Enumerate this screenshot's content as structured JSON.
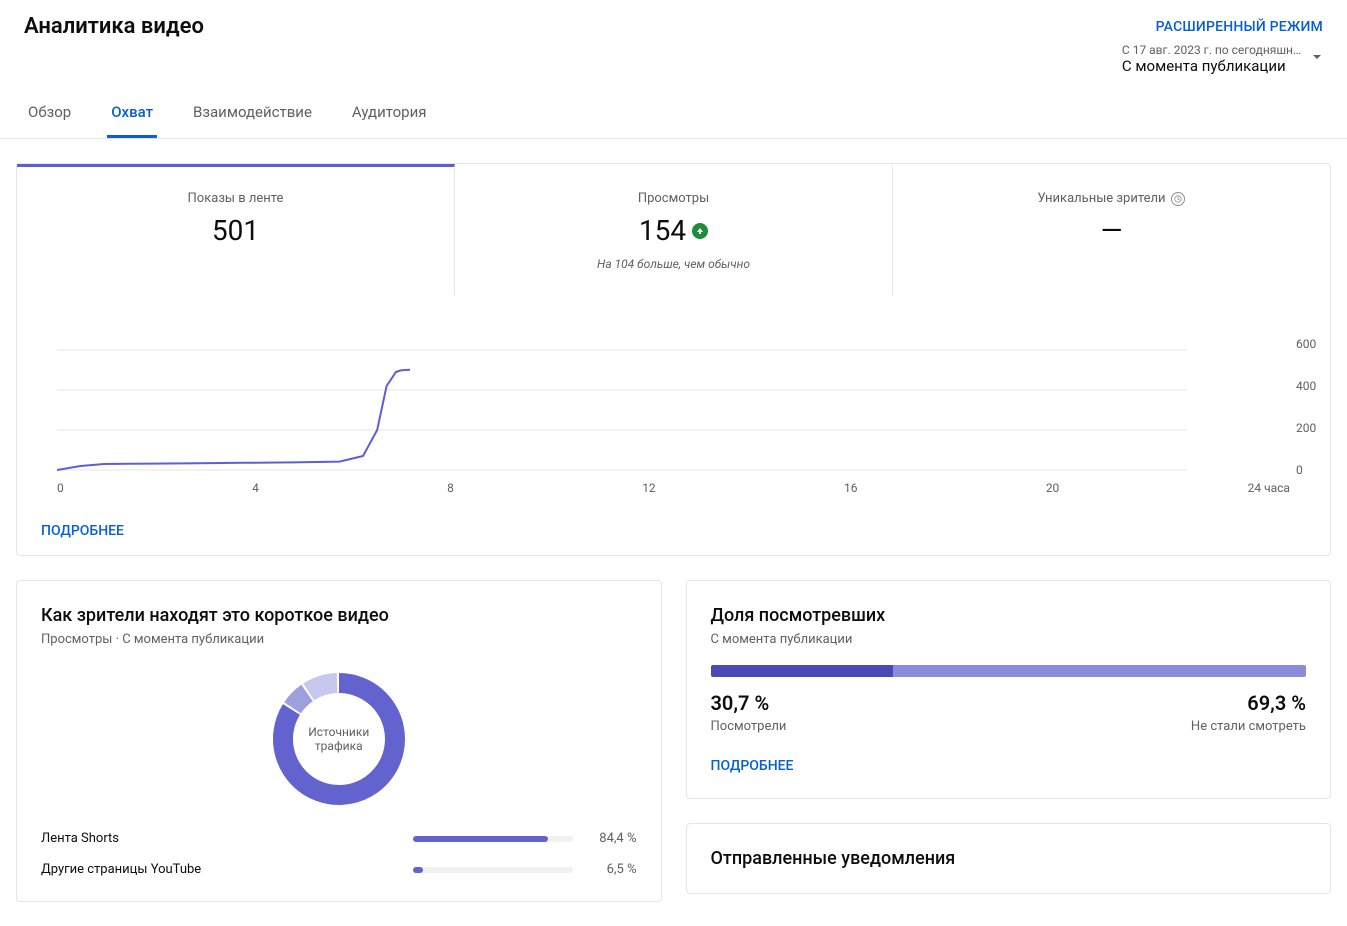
{
  "header": {
    "title": "Аналитика видео",
    "advanced_mode": "РАСШИРЕННЫЙ РЕЖИМ"
  },
  "date_picker": {
    "range_text": "С 17 авг. 2023 г. по сегодняшн…",
    "mode_text": "С момента публикации"
  },
  "tabs": [
    "Обзор",
    "Охват",
    "Взаимодействие",
    "Аудитория"
  ],
  "active_tab_index": 1,
  "metrics": {
    "impressions": {
      "label": "Показы в ленте",
      "value": "501"
    },
    "views": {
      "label": "Просмотры",
      "value": "154",
      "sub": "На 104 больше, чем обычно"
    },
    "unique": {
      "label": "Уникальные зрители",
      "value": "—"
    }
  },
  "more_link": "ПОДРОБНЕЕ",
  "chart_data": {
    "type": "line",
    "title": "",
    "xlabel": "",
    "ylabel": "",
    "x_ticks": [
      "0",
      "4",
      "8",
      "12",
      "16",
      "20",
      "24 часа"
    ],
    "y_ticks": [
      "600",
      "400",
      "200",
      "0"
    ],
    "xlim": [
      0,
      24
    ],
    "ylim": [
      0,
      600
    ],
    "series": [
      {
        "name": "Показы в ленте",
        "x": [
          0,
          0.5,
          1,
          2,
          3,
          4,
          5,
          6,
          6.5,
          6.8,
          7,
          7.2,
          7.3,
          7.4,
          7.5
        ],
        "y": [
          0,
          20,
          30,
          32,
          34,
          36,
          38,
          42,
          70,
          200,
          420,
          490,
          498,
          500,
          501
        ]
      }
    ]
  },
  "traffic_card": {
    "title": "Как зрители находят это короткое видео",
    "sub": "Просмотры · С момента публикации",
    "center": "Источники трафика",
    "sources": [
      {
        "name": "Лента Shorts",
        "pct": "84,4 %",
        "pct_num": 84.4
      },
      {
        "name": "Другие страницы YouTube",
        "pct": "6,5 %",
        "pct_num": 6.5
      }
    ]
  },
  "watched_card": {
    "title": "Доля посмотревших",
    "sub": "С момента публикации",
    "watched": {
      "pct": "30,7 %",
      "num": 30.7,
      "label": "Посмотрели"
    },
    "skipped": {
      "pct": "69,3 %",
      "num": 69.3,
      "label": "Не стали смотреть"
    }
  },
  "notifications_card": {
    "title": "Отправленные уведомления"
  }
}
